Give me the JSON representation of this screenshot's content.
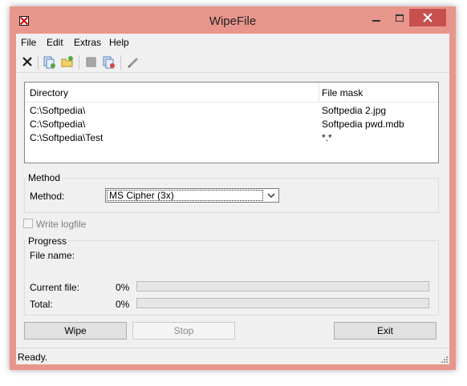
{
  "window": {
    "title": "WipeFile"
  },
  "menu": [
    "File",
    "Edit",
    "Extras",
    "Help"
  ],
  "toolbar": {
    "icons": [
      "delete-icon",
      "add-folder-icon",
      "add-file-icon",
      "clear-icon",
      "remove-icon",
      "edit-icon"
    ]
  },
  "list": {
    "headers": {
      "directory": "Directory",
      "file_mask": "File mask"
    },
    "rows": [
      {
        "directory": "C:\\Softpedia\\",
        "file_mask": "Softpedia 2.jpg"
      },
      {
        "directory": "C:\\Softpedia\\",
        "file_mask": "Softpedia pwd.mdb"
      },
      {
        "directory": "C:\\Softpedia\\Test",
        "file_mask": "*.*"
      }
    ]
  },
  "method": {
    "group_label": "Method",
    "label": "Method:",
    "selected": "MS Cipher (3x)"
  },
  "logfile": {
    "label": "Write logfile",
    "checked": false
  },
  "progress": {
    "group_label": "Progress",
    "file_name_label": "File name:",
    "current_file_label": "Current file:",
    "current_file_value": "0%",
    "total_label": "Total:",
    "total_value": "0%"
  },
  "buttons": {
    "wipe": "Wipe",
    "stop": "Stop",
    "exit": "Exit"
  },
  "status": {
    "text": "Ready."
  },
  "colors": {
    "frame": "#e8968c",
    "close_button": "#c7504f"
  }
}
